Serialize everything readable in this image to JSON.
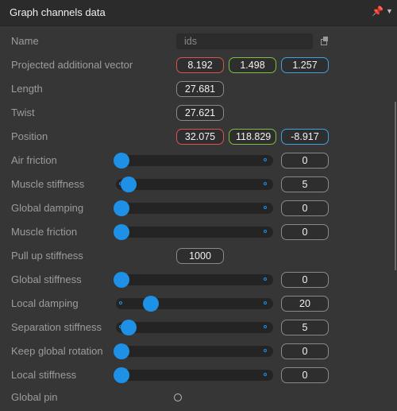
{
  "header": {
    "title": "Graph channels data"
  },
  "name_row": {
    "label": "Name",
    "value": "ids"
  },
  "projected": {
    "label": "Projected additional vector",
    "x": "8.192",
    "y": "1.498",
    "z": "1.257"
  },
  "length": {
    "label": "Length",
    "value": "27.681"
  },
  "twist": {
    "label": "Twist",
    "value": "27.621"
  },
  "position": {
    "label": "Position",
    "x": "32.075",
    "y": "118.829",
    "z": "-8.917"
  },
  "sliders": [
    {
      "label": "Air  friction",
      "value": "0",
      "level": 0.0
    },
    {
      "label": "Muscle stiffness",
      "value": "5",
      "level": 0.05
    },
    {
      "label": "Global damping",
      "value": "0",
      "level": 0.0
    },
    {
      "label": "Muscle friction",
      "value": "0",
      "level": 0.0
    }
  ],
  "pull_up": {
    "label": "Pull up stiffness",
    "value": "1000"
  },
  "sliders2": [
    {
      "label": "Global stiffness",
      "value": "0",
      "level": 0.0
    },
    {
      "label": "Local damping",
      "value": "20",
      "level": 0.2
    },
    {
      "label": "Separation stiffness",
      "value": "5",
      "level": 0.05
    },
    {
      "label": "Keep global rotation",
      "value": "0",
      "level": 0.0
    },
    {
      "label": "Local stiffness",
      "value": "0",
      "level": 0.0
    }
  ],
  "global_pin": {
    "label": "Global  pin"
  },
  "icons": {
    "pin": "pin-icon",
    "menu": "chevron-down-icon",
    "copy": "copy-icon"
  },
  "colors": {
    "accent": "#1e90e6",
    "x_axis": "#d9534f",
    "y_axis": "#7fbf3f",
    "z_axis": "#3aa3e0"
  }
}
